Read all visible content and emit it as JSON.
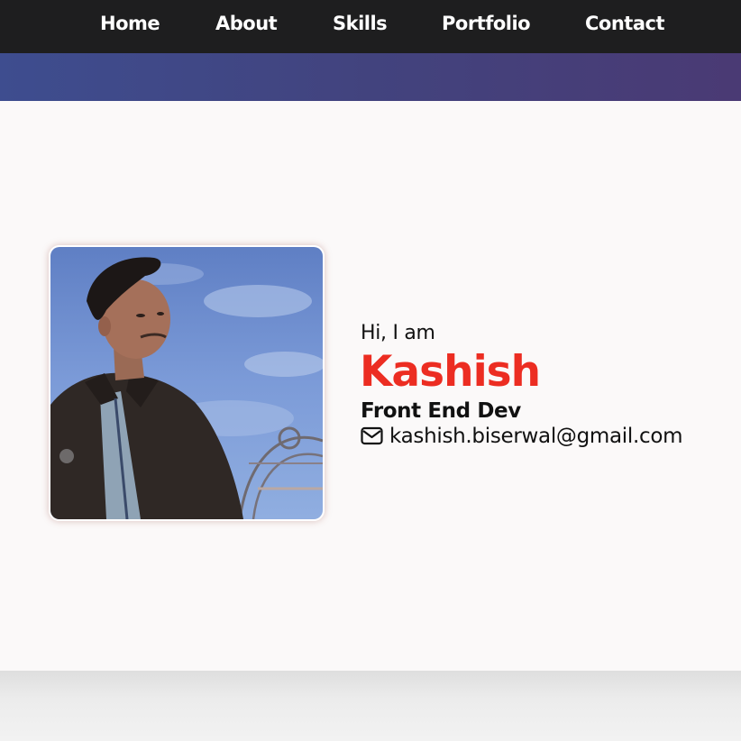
{
  "nav": {
    "items": [
      {
        "label": "Home"
      },
      {
        "label": "About"
      },
      {
        "label": "Skills"
      },
      {
        "label": "Portfolio"
      },
      {
        "label": "Contact"
      }
    ]
  },
  "hero": {
    "greeting": "Hi, I am",
    "name": "Kashish",
    "role": "Front End Dev",
    "email": "kashish.biserwal@gmail.com",
    "email_icon": "envelope-icon",
    "profile_photo": "profile-photo"
  },
  "colors": {
    "navbar_bg": "#1e1e1f",
    "banner_start": "#3e4d8f",
    "banner_end": "#4a3a74",
    "name_accent": "#ec2d22",
    "hero_bg": "#fbf9f9"
  }
}
